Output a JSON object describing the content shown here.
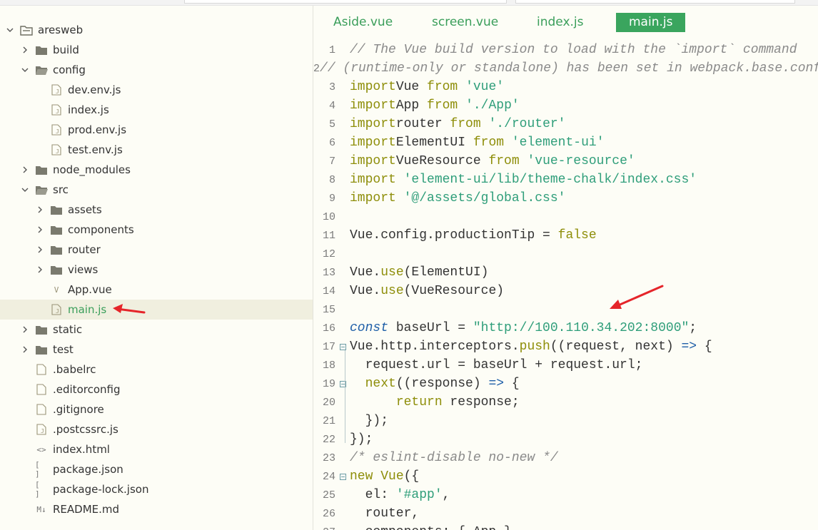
{
  "tree": [
    {
      "label": "aresweb",
      "type": "project",
      "depth": 0,
      "expanded": true
    },
    {
      "label": "build",
      "type": "folder",
      "depth": 1,
      "expanded": false
    },
    {
      "label": "config",
      "type": "folder",
      "depth": 1,
      "expanded": true
    },
    {
      "label": "dev.env.js",
      "type": "js",
      "depth": 2
    },
    {
      "label": "index.js",
      "type": "js",
      "depth": 2
    },
    {
      "label": "prod.env.js",
      "type": "js",
      "depth": 2
    },
    {
      "label": "test.env.js",
      "type": "js",
      "depth": 2
    },
    {
      "label": "node_modules",
      "type": "folder",
      "depth": 1,
      "expanded": false
    },
    {
      "label": "src",
      "type": "folder",
      "depth": 1,
      "expanded": true
    },
    {
      "label": "assets",
      "type": "folder",
      "depth": 2,
      "expanded": false
    },
    {
      "label": "components",
      "type": "folder",
      "depth": 2,
      "expanded": false
    },
    {
      "label": "router",
      "type": "folder",
      "depth": 2,
      "expanded": false
    },
    {
      "label": "views",
      "type": "folder",
      "depth": 2,
      "expanded": false
    },
    {
      "label": "App.vue",
      "type": "vue",
      "depth": 2
    },
    {
      "label": "main.js",
      "type": "js",
      "depth": 2,
      "selected": true
    },
    {
      "label": "static",
      "type": "folder",
      "depth": 1,
      "expanded": false
    },
    {
      "label": "test",
      "type": "folder",
      "depth": 1,
      "expanded": false
    },
    {
      "label": ".babelrc",
      "type": "file",
      "depth": 1
    },
    {
      "label": ".editorconfig",
      "type": "file",
      "depth": 1
    },
    {
      "label": ".gitignore",
      "type": "file",
      "depth": 1
    },
    {
      "label": ".postcssrc.js",
      "type": "js",
      "depth": 1
    },
    {
      "label": "index.html",
      "type": "html",
      "depth": 1
    },
    {
      "label": "package.json",
      "type": "json",
      "depth": 1
    },
    {
      "label": "package-lock.json",
      "type": "json",
      "depth": 1
    },
    {
      "label": "README.md",
      "type": "md",
      "depth": 1
    }
  ],
  "icons": {
    "md_badge": "M↓",
    "html_badge": "<>",
    "json_badge": "[ ]",
    "vue_badge": "V"
  },
  "tabs": [
    {
      "label": "Aside.vue",
      "active": false
    },
    {
      "label": "screen.vue",
      "active": false
    },
    {
      "label": "index.js",
      "active": false
    },
    {
      "label": "main.js",
      "active": true
    }
  ],
  "code": [
    {
      "n": "1",
      "t": [
        [
          "cm",
          "// The Vue build version to load with the `import` command"
        ]
      ]
    },
    {
      "n": "2",
      "t": [
        [
          "cm",
          "// (runtime-only or standalone) has been set in webpack.base.conf with an alias."
        ]
      ]
    },
    {
      "n": "3",
      "t": [
        [
          "kw",
          "import"
        ],
        [
          "",
          "Vue "
        ],
        [
          "kw",
          "from"
        ],
        [
          "",
          " "
        ],
        [
          "str",
          "'vue'"
        ]
      ]
    },
    {
      "n": "4",
      "t": [
        [
          "kw",
          "import"
        ],
        [
          "",
          "App "
        ],
        [
          "kw",
          "from"
        ],
        [
          "",
          " "
        ],
        [
          "str",
          "'./App'"
        ]
      ]
    },
    {
      "n": "5",
      "t": [
        [
          "kw",
          "import"
        ],
        [
          "",
          "router "
        ],
        [
          "kw",
          "from"
        ],
        [
          "",
          " "
        ],
        [
          "str",
          "'./router'"
        ]
      ]
    },
    {
      "n": "6",
      "t": [
        [
          "kw",
          "import"
        ],
        [
          "",
          "ElementUI "
        ],
        [
          "kw",
          "from"
        ],
        [
          "",
          " "
        ],
        [
          "str",
          "'element-ui'"
        ]
      ]
    },
    {
      "n": "7",
      "t": [
        [
          "kw",
          "import"
        ],
        [
          "",
          "VueResource "
        ],
        [
          "kw",
          "from"
        ],
        [
          "",
          " "
        ],
        [
          "str",
          "'vue-resource'"
        ]
      ]
    },
    {
      "n": "8",
      "t": [
        [
          "kw",
          "import"
        ],
        [
          "",
          " "
        ],
        [
          "str",
          "'element-ui/lib/theme-chalk/index.css'"
        ]
      ]
    },
    {
      "n": "9",
      "t": [
        [
          "kw",
          "import"
        ],
        [
          "",
          " "
        ],
        [
          "str",
          "'@/assets/global.css'"
        ]
      ]
    },
    {
      "n": "10",
      "t": []
    },
    {
      "n": "11",
      "t": [
        [
          "",
          "Vue.config.productionTip = "
        ],
        [
          "kw",
          "false"
        ]
      ]
    },
    {
      "n": "12",
      "t": []
    },
    {
      "n": "13",
      "t": [
        [
          "",
          "Vue."
        ],
        [
          "kw",
          "use"
        ],
        [
          "",
          "(ElementUI)"
        ]
      ]
    },
    {
      "n": "14",
      "t": [
        [
          "",
          "Vue."
        ],
        [
          "kw",
          "use"
        ],
        [
          "",
          "(VueResource)"
        ]
      ]
    },
    {
      "n": "15",
      "t": []
    },
    {
      "n": "16",
      "t": [
        [
          "kwb",
          "const"
        ],
        [
          "",
          " baseUrl = "
        ],
        [
          "str",
          "\"http://100.110.34.202:8000\""
        ],
        [
          "",
          ";"
        ]
      ]
    },
    {
      "n": "17",
      "fold": true,
      "t": [
        [
          "",
          "Vue.http.interceptors."
        ],
        [
          "kw",
          "push"
        ],
        [
          "",
          "((request, next) "
        ],
        [
          "arr",
          "=>"
        ],
        [
          "",
          " {"
        ]
      ]
    },
    {
      "n": "18",
      "t": [
        [
          "",
          "  request.url = baseUrl + request.url;"
        ]
      ]
    },
    {
      "n": "19",
      "fold": true,
      "t": [
        [
          "",
          "  "
        ],
        [
          "kw",
          "next"
        ],
        [
          "",
          "((response) "
        ],
        [
          "arr",
          "=>"
        ],
        [
          "",
          " {"
        ]
      ]
    },
    {
      "n": "20",
      "t": [
        [
          "",
          "      "
        ],
        [
          "kw",
          "return"
        ],
        [
          "",
          " response;"
        ]
      ]
    },
    {
      "n": "21",
      "t": [
        [
          "",
          "  });"
        ]
      ]
    },
    {
      "n": "22",
      "t": [
        [
          "",
          "});"
        ]
      ]
    },
    {
      "n": "23",
      "t": [
        [
          "cm",
          "/* eslint-disable no-new */"
        ]
      ]
    },
    {
      "n": "24",
      "fold": true,
      "t": [
        [
          "kw",
          "new"
        ],
        [
          "",
          " "
        ],
        [
          "kw",
          "Vue"
        ],
        [
          "",
          "({"
        ]
      ]
    },
    {
      "n": "25",
      "t": [
        [
          "",
          "  el: "
        ],
        [
          "str",
          "'#app'"
        ],
        [
          "",
          ","
        ]
      ]
    },
    {
      "n": "26",
      "t": [
        [
          "",
          "  router,"
        ]
      ]
    },
    {
      "n": "27",
      "t": [
        [
          "",
          "  components: { App },"
        ]
      ]
    }
  ]
}
